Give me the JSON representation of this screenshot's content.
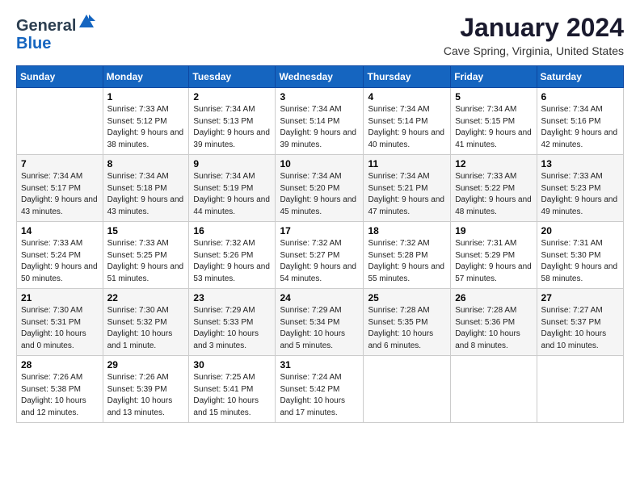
{
  "logo": {
    "general": "General",
    "blue": "Blue"
  },
  "header": {
    "month_title": "January 2024",
    "location": "Cave Spring, Virginia, United States"
  },
  "weekdays": [
    "Sunday",
    "Monday",
    "Tuesday",
    "Wednesday",
    "Thursday",
    "Friday",
    "Saturday"
  ],
  "weeks": [
    [
      {
        "day": "",
        "sunrise": "",
        "sunset": "",
        "daylight": ""
      },
      {
        "day": "1",
        "sunrise": "Sunrise: 7:33 AM",
        "sunset": "Sunset: 5:12 PM",
        "daylight": "Daylight: 9 hours and 38 minutes."
      },
      {
        "day": "2",
        "sunrise": "Sunrise: 7:34 AM",
        "sunset": "Sunset: 5:13 PM",
        "daylight": "Daylight: 9 hours and 39 minutes."
      },
      {
        "day": "3",
        "sunrise": "Sunrise: 7:34 AM",
        "sunset": "Sunset: 5:14 PM",
        "daylight": "Daylight: 9 hours and 39 minutes."
      },
      {
        "day": "4",
        "sunrise": "Sunrise: 7:34 AM",
        "sunset": "Sunset: 5:14 PM",
        "daylight": "Daylight: 9 hours and 40 minutes."
      },
      {
        "day": "5",
        "sunrise": "Sunrise: 7:34 AM",
        "sunset": "Sunset: 5:15 PM",
        "daylight": "Daylight: 9 hours and 41 minutes."
      },
      {
        "day": "6",
        "sunrise": "Sunrise: 7:34 AM",
        "sunset": "Sunset: 5:16 PM",
        "daylight": "Daylight: 9 hours and 42 minutes."
      }
    ],
    [
      {
        "day": "7",
        "sunrise": "Sunrise: 7:34 AM",
        "sunset": "Sunset: 5:17 PM",
        "daylight": "Daylight: 9 hours and 43 minutes."
      },
      {
        "day": "8",
        "sunrise": "Sunrise: 7:34 AM",
        "sunset": "Sunset: 5:18 PM",
        "daylight": "Daylight: 9 hours and 43 minutes."
      },
      {
        "day": "9",
        "sunrise": "Sunrise: 7:34 AM",
        "sunset": "Sunset: 5:19 PM",
        "daylight": "Daylight: 9 hours and 44 minutes."
      },
      {
        "day": "10",
        "sunrise": "Sunrise: 7:34 AM",
        "sunset": "Sunset: 5:20 PM",
        "daylight": "Daylight: 9 hours and 45 minutes."
      },
      {
        "day": "11",
        "sunrise": "Sunrise: 7:34 AM",
        "sunset": "Sunset: 5:21 PM",
        "daylight": "Daylight: 9 hours and 47 minutes."
      },
      {
        "day": "12",
        "sunrise": "Sunrise: 7:33 AM",
        "sunset": "Sunset: 5:22 PM",
        "daylight": "Daylight: 9 hours and 48 minutes."
      },
      {
        "day": "13",
        "sunrise": "Sunrise: 7:33 AM",
        "sunset": "Sunset: 5:23 PM",
        "daylight": "Daylight: 9 hours and 49 minutes."
      }
    ],
    [
      {
        "day": "14",
        "sunrise": "Sunrise: 7:33 AM",
        "sunset": "Sunset: 5:24 PM",
        "daylight": "Daylight: 9 hours and 50 minutes."
      },
      {
        "day": "15",
        "sunrise": "Sunrise: 7:33 AM",
        "sunset": "Sunset: 5:25 PM",
        "daylight": "Daylight: 9 hours and 51 minutes."
      },
      {
        "day": "16",
        "sunrise": "Sunrise: 7:32 AM",
        "sunset": "Sunset: 5:26 PM",
        "daylight": "Daylight: 9 hours and 53 minutes."
      },
      {
        "day": "17",
        "sunrise": "Sunrise: 7:32 AM",
        "sunset": "Sunset: 5:27 PM",
        "daylight": "Daylight: 9 hours and 54 minutes."
      },
      {
        "day": "18",
        "sunrise": "Sunrise: 7:32 AM",
        "sunset": "Sunset: 5:28 PM",
        "daylight": "Daylight: 9 hours and 55 minutes."
      },
      {
        "day": "19",
        "sunrise": "Sunrise: 7:31 AM",
        "sunset": "Sunset: 5:29 PM",
        "daylight": "Daylight: 9 hours and 57 minutes."
      },
      {
        "day": "20",
        "sunrise": "Sunrise: 7:31 AM",
        "sunset": "Sunset: 5:30 PM",
        "daylight": "Daylight: 9 hours and 58 minutes."
      }
    ],
    [
      {
        "day": "21",
        "sunrise": "Sunrise: 7:30 AM",
        "sunset": "Sunset: 5:31 PM",
        "daylight": "Daylight: 10 hours and 0 minutes."
      },
      {
        "day": "22",
        "sunrise": "Sunrise: 7:30 AM",
        "sunset": "Sunset: 5:32 PM",
        "daylight": "Daylight: 10 hours and 1 minute."
      },
      {
        "day": "23",
        "sunrise": "Sunrise: 7:29 AM",
        "sunset": "Sunset: 5:33 PM",
        "daylight": "Daylight: 10 hours and 3 minutes."
      },
      {
        "day": "24",
        "sunrise": "Sunrise: 7:29 AM",
        "sunset": "Sunset: 5:34 PM",
        "daylight": "Daylight: 10 hours and 5 minutes."
      },
      {
        "day": "25",
        "sunrise": "Sunrise: 7:28 AM",
        "sunset": "Sunset: 5:35 PM",
        "daylight": "Daylight: 10 hours and 6 minutes."
      },
      {
        "day": "26",
        "sunrise": "Sunrise: 7:28 AM",
        "sunset": "Sunset: 5:36 PM",
        "daylight": "Daylight: 10 hours and 8 minutes."
      },
      {
        "day": "27",
        "sunrise": "Sunrise: 7:27 AM",
        "sunset": "Sunset: 5:37 PM",
        "daylight": "Daylight: 10 hours and 10 minutes."
      }
    ],
    [
      {
        "day": "28",
        "sunrise": "Sunrise: 7:26 AM",
        "sunset": "Sunset: 5:38 PM",
        "daylight": "Daylight: 10 hours and 12 minutes."
      },
      {
        "day": "29",
        "sunrise": "Sunrise: 7:26 AM",
        "sunset": "Sunset: 5:39 PM",
        "daylight": "Daylight: 10 hours and 13 minutes."
      },
      {
        "day": "30",
        "sunrise": "Sunrise: 7:25 AM",
        "sunset": "Sunset: 5:41 PM",
        "daylight": "Daylight: 10 hours and 15 minutes."
      },
      {
        "day": "31",
        "sunrise": "Sunrise: 7:24 AM",
        "sunset": "Sunset: 5:42 PM",
        "daylight": "Daylight: 10 hours and 17 minutes."
      },
      {
        "day": "",
        "sunrise": "",
        "sunset": "",
        "daylight": ""
      },
      {
        "day": "",
        "sunrise": "",
        "sunset": "",
        "daylight": ""
      },
      {
        "day": "",
        "sunrise": "",
        "sunset": "",
        "daylight": ""
      }
    ]
  ]
}
